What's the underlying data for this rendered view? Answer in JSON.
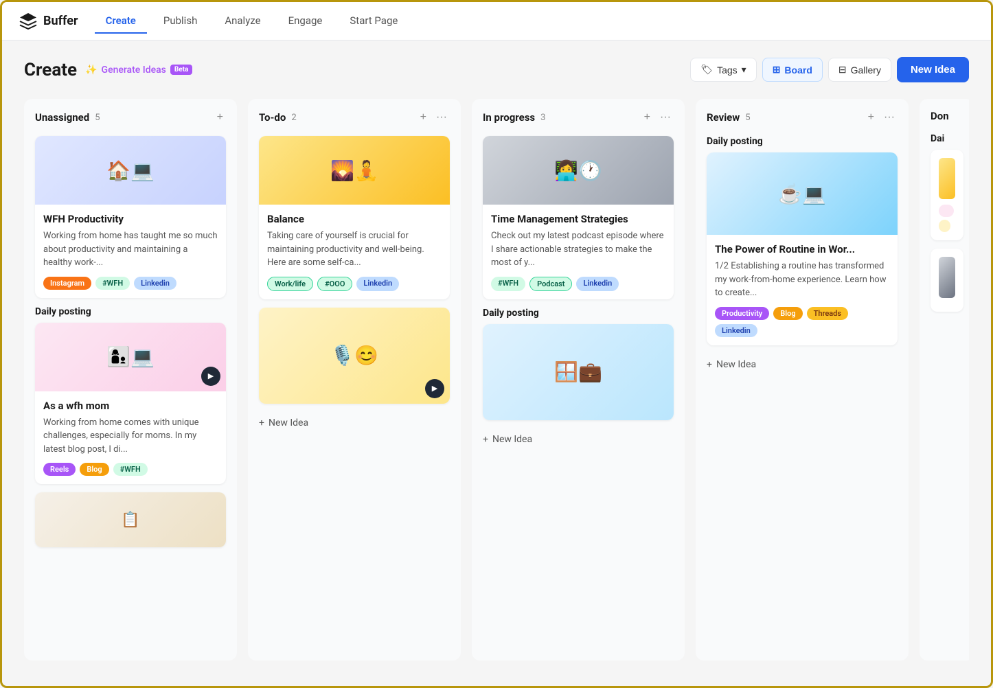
{
  "nav": {
    "logo_text": "Buffer",
    "items": [
      {
        "label": "Create",
        "active": true
      },
      {
        "label": "Publish",
        "active": false
      },
      {
        "label": "Analyze",
        "active": false
      },
      {
        "label": "Engage",
        "active": false
      },
      {
        "label": "Start Page",
        "active": false
      }
    ]
  },
  "header": {
    "title": "Create",
    "generate_label": "Generate Ideas",
    "beta_label": "Beta",
    "tags_label": "Tags",
    "board_label": "Board",
    "gallery_label": "Gallery",
    "new_idea_label": "New Idea"
  },
  "columns": [
    {
      "id": "unassigned",
      "title": "Unassigned",
      "count": 5,
      "cards": [
        {
          "title": "WFH Productivity",
          "desc": "Working from home has taught me so much about productivity and maintaining a healthy work-...",
          "tags": [
            "Instagram",
            "#WFH",
            "Linkedin"
          ],
          "tag_classes": [
            "tag-instagram",
            "tag-wfh",
            "tag-linkedin"
          ],
          "img_type": "wfh"
        },
        {
          "title": "As a wfh mom",
          "desc": "Working from home comes with unique challenges, especially for moms. In my latest blog post, I di...",
          "tags": [
            "Reels",
            "Blog",
            "#WFH"
          ],
          "tag_classes": [
            "tag-reels",
            "tag-blog",
            "tag-wfh"
          ],
          "img_type": "mom",
          "has_video": true
        }
      ],
      "group_label": "Daily posting"
    },
    {
      "id": "todo",
      "title": "To-do",
      "count": 2,
      "cards": [
        {
          "title": "Balance",
          "desc": "Taking care of yourself is crucial for maintaining productivity and well-being. Here are some self-ca...",
          "tags": [
            "Work/life",
            "#OOO",
            "Linkedin"
          ],
          "tag_classes": [
            "tag-worklife",
            "tag-ooo",
            "tag-linkedin"
          ],
          "img_type": "balance"
        }
      ],
      "podcast_card": {
        "img_type": "podcast",
        "has_video": true
      },
      "new_idea_label": "+ New Idea"
    },
    {
      "id": "in-progress",
      "title": "In progress",
      "count": 3,
      "cards": [
        {
          "title": "Time Management Strategies",
          "desc": "Check out my latest podcast episode where I share actionable strategies to make the most of y...",
          "tags": [
            "#WFH",
            "Podcast",
            "Linkedin"
          ],
          "tag_classes": [
            "tag-wfh",
            "tag-podcast",
            "tag-linkedin"
          ],
          "img_type": "time"
        }
      ],
      "group_label": "Daily posting",
      "daily_img_type": "daily",
      "new_idea_label": "+ New Idea"
    },
    {
      "id": "review",
      "title": "Review",
      "count": 5,
      "group_label": "Daily posting",
      "review_card": {
        "title": "The Power of Routine in Wor...",
        "desc": "1/2 Establishing a routine has transformed my work-from-home experience. Learn how to create...",
        "tags": [
          "Productivity",
          "Blog",
          "Threads",
          "Linkedin"
        ],
        "tag_classes": [
          "tag-productivity",
          "tag-blog",
          "tag-threads",
          "tag-linkedin"
        ],
        "img_type": "routine"
      },
      "new_idea_label": "+ New Idea"
    }
  ],
  "partial_column": {
    "title": "Don",
    "group_label": "Dai"
  }
}
